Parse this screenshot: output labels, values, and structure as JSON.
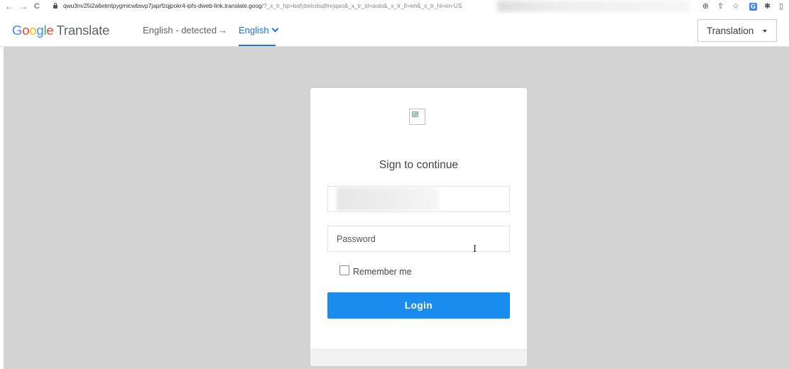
{
  "browser": {
    "nav": {
      "back": "←",
      "forward": "→",
      "reload": "C"
    },
    "url_host": "qwu3nv25i2a6etmtpygmicwbsvp7japrfzqjpokr4-ipfs-dweb-link.translate.goog",
    "url_path": "/?_x_tr_hp=bafybeicdsqfmrjqao&_x_tr_sl=auto&_x_tr_tl=en&_x_tr_hl=en-US",
    "icons": {
      "zoom": "⊕",
      "share": "⇪",
      "star": "☆",
      "translate": "G",
      "extensions": "✱",
      "sidepanel": "▯"
    }
  },
  "header": {
    "logo": [
      "G",
      "o",
      "o",
      "g",
      "l",
      "e"
    ],
    "logo_suffix": "Translate",
    "source_language": "English - detected",
    "arrow": "→",
    "target_language": "English",
    "view_select": "Translation"
  },
  "login": {
    "title": "Sign to continue",
    "password_placeholder": "Password",
    "remember_label": "Remember me",
    "button_label": "Login"
  },
  "colors": {
    "accent": "#1a73e8",
    "button": "#1a8cf0",
    "backdrop": "#d2d2d2"
  }
}
